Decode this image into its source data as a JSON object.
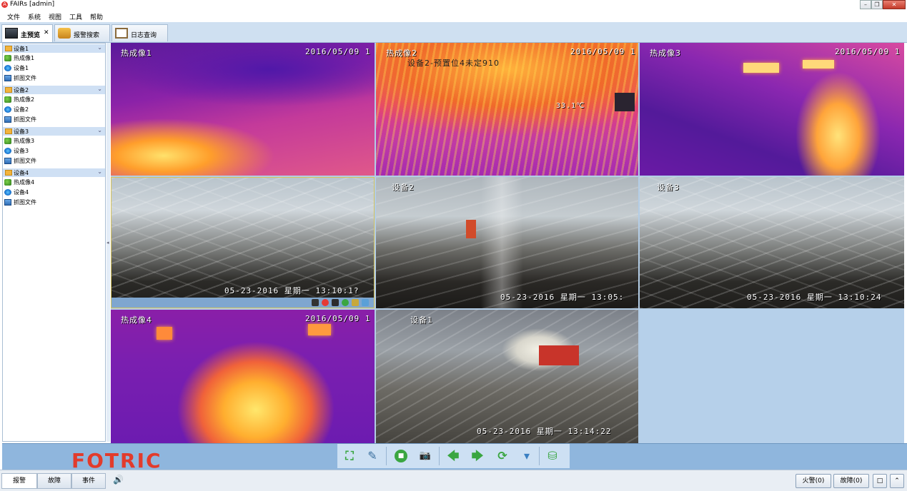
{
  "window": {
    "title": "FAIRs [admin]",
    "minimize": "–",
    "restore": "❐",
    "close": "✕",
    "icon_glyph": "A"
  },
  "menu": [
    "文件",
    "系统",
    "视图",
    "工具",
    "帮助"
  ],
  "tabs": [
    {
      "label": "主预览",
      "close": "✕",
      "active": true
    },
    {
      "label": "报警搜索",
      "active": false
    },
    {
      "label": "日志查询",
      "active": false
    }
  ],
  "sidebar": {
    "groups": [
      {
        "label": "设备1",
        "items": [
          "热成像1",
          "设备1",
          "抓图文件"
        ]
      },
      {
        "label": "设备2",
        "items": [
          "热成像2",
          "设备2",
          "抓图文件"
        ]
      },
      {
        "label": "设备3",
        "items": [
          "热成像3",
          "设备3",
          "抓图文件"
        ]
      },
      {
        "label": "设备4",
        "items": [
          "热成像4",
          "设备4",
          "抓图文件"
        ]
      }
    ],
    "chevron": "⌄",
    "collapse_arrow": "◂"
  },
  "videos": [
    {
      "name": "热成像1",
      "stamp": "2016/05/09 1"
    },
    {
      "name": "热成像2",
      "stamp": "2016/05/09 1",
      "preset": "设备2-预置位4未定910",
      "temp": "33.1℃"
    },
    {
      "name": "热成像3",
      "stamp": "2016/05/09 1"
    },
    {
      "name": "",
      "stamp": "05-23-2016 星期一 13:10:1?"
    },
    {
      "name": "设备2",
      "stamp": "05-23-2016 星期一 13:05:"
    },
    {
      "name": "设备3",
      "stamp": "05-23-2016 星期一 13:10:24"
    },
    {
      "name": "热成像4",
      "stamp": "2016/05/09 1"
    },
    {
      "name": "设备1",
      "stamp": "05-23-2016 星期一 13:14:22"
    }
  ],
  "brand": {
    "logo": "FOTRIC",
    "color": "#e23b2c"
  },
  "controls": {
    "fullscreen": "⛶",
    "edit": "✎",
    "stop": "■",
    "snapshot": "📷",
    "prev": "🡄",
    "next": "🡆",
    "refresh": "⟳",
    "dropdown": "▾",
    "layout": "⛁"
  },
  "statusbar": {
    "tabs": [
      "报警",
      "故障",
      "事件"
    ],
    "speaker": "🔊",
    "fire_alarm": "火警(0)",
    "fault": "故障(0)",
    "btn_restore": "□",
    "btn_up": "⌃"
  }
}
